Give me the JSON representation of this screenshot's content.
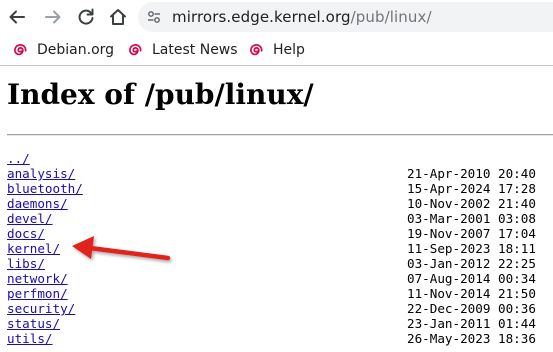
{
  "toolbar": {
    "back_icon": "back-arrow-icon",
    "forward_icon": "forward-arrow-icon",
    "reload_icon": "reload-icon",
    "home_icon": "home-icon",
    "site_info_icon": "site-info-icon",
    "url_host": "mirrors.edge.kernel.org",
    "url_path": "/pub/linux/"
  },
  "bookmarks": [
    {
      "label": "Debian.org",
      "icon": "debian-swirl-icon"
    },
    {
      "label": "Latest News",
      "icon": "debian-swirl-icon"
    },
    {
      "label": "Help",
      "icon": "debian-swirl-icon"
    }
  ],
  "page": {
    "title": "Index of /pub/linux/",
    "entries": [
      {
        "name": "../",
        "date": ""
      },
      {
        "name": "analysis/",
        "date": "21-Apr-2010 20:40"
      },
      {
        "name": "bluetooth/",
        "date": "15-Apr-2024 17:28"
      },
      {
        "name": "daemons/",
        "date": "10-Nov-2002 21:40"
      },
      {
        "name": "devel/",
        "date": "03-Mar-2001 03:08"
      },
      {
        "name": "docs/",
        "date": "19-Nov-2007 17:04"
      },
      {
        "name": "kernel/",
        "date": "11-Sep-2023 18:11"
      },
      {
        "name": "libs/",
        "date": "03-Jan-2012 22:25"
      },
      {
        "name": "network/",
        "date": "07-Aug-2014 00:34"
      },
      {
        "name": "perfmon/",
        "date": "11-Nov-2014 21:50"
      },
      {
        "name": "security/",
        "date": "22-Dec-2009 00:36"
      },
      {
        "name": "status/",
        "date": "23-Jan-2011 01:44"
      },
      {
        "name": "utils/",
        "date": "26-May-2023 18:36"
      }
    ]
  },
  "annotation": {
    "icon": "red-arrow-annotation",
    "color": "#e2231a",
    "points_to": "kernel/"
  },
  "colors": {
    "link": "#1a0dab",
    "omnibox_bg": "#f1f3f4",
    "debian_red": "#d70751"
  }
}
